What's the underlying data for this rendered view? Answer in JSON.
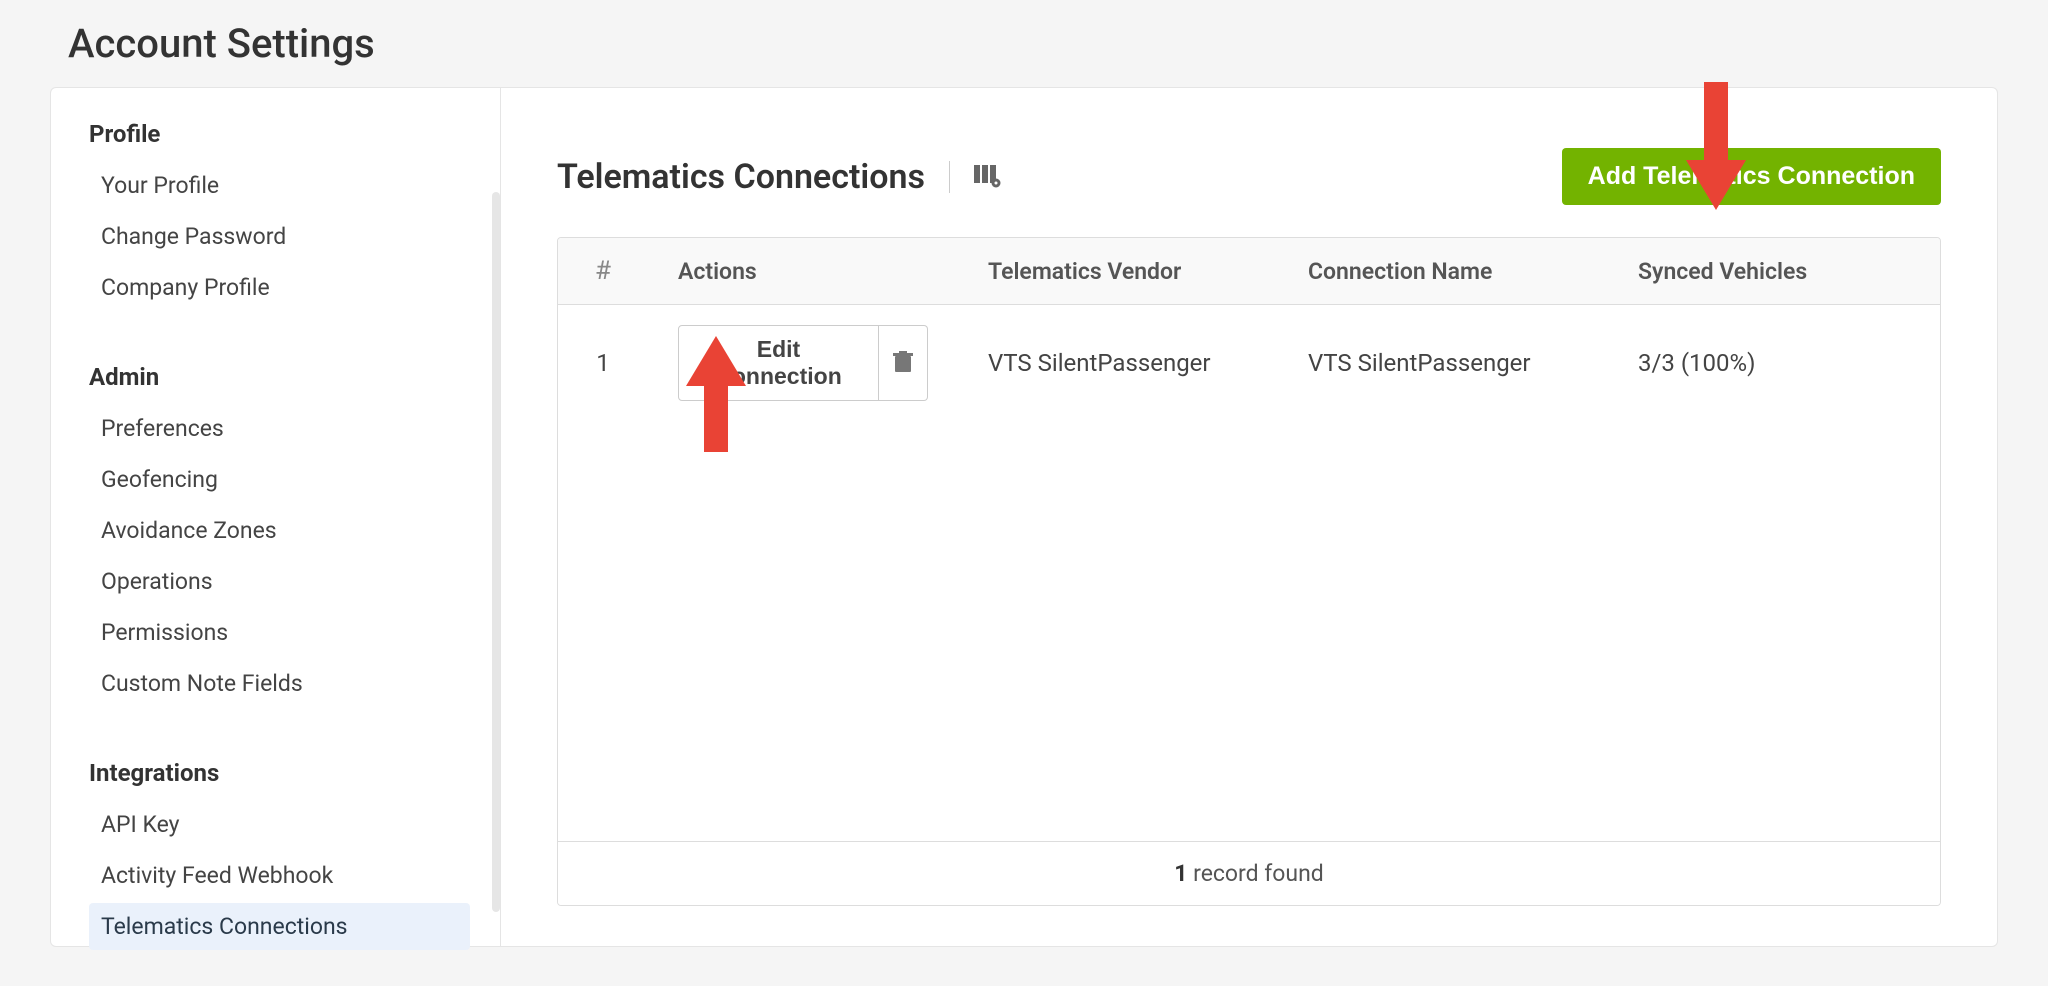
{
  "page_title": "Account Settings",
  "sidebar": {
    "sections": [
      {
        "header": "Profile",
        "items": [
          {
            "label": "Your Profile",
            "active": false
          },
          {
            "label": "Change Password",
            "active": false
          },
          {
            "label": "Company Profile",
            "active": false
          }
        ]
      },
      {
        "header": "Admin",
        "items": [
          {
            "label": "Preferences",
            "active": false
          },
          {
            "label": "Geofencing",
            "active": false
          },
          {
            "label": "Avoidance Zones",
            "active": false
          },
          {
            "label": "Operations",
            "active": false
          },
          {
            "label": "Permissions",
            "active": false
          },
          {
            "label": "Custom Note Fields",
            "active": false
          }
        ]
      },
      {
        "header": "Integrations",
        "items": [
          {
            "label": "API Key",
            "active": false
          },
          {
            "label": "Activity Feed Webhook",
            "active": false
          },
          {
            "label": "Telematics Connections",
            "active": true
          }
        ]
      }
    ]
  },
  "main": {
    "title": "Telematics Connections",
    "add_button": "Add Telematics Connection",
    "columns": {
      "num": "#",
      "actions": "Actions",
      "vendor": "Telematics Vendor",
      "name": "Connection Name",
      "synced": "Synced Vehicles"
    },
    "rows": [
      {
        "num": "1",
        "edit_label": "Edit Connection",
        "vendor": "VTS SilentPassenger",
        "name": "VTS SilentPassenger",
        "synced": "3/3 (100%)"
      }
    ],
    "footer_count": "1",
    "footer_text": " record found"
  }
}
